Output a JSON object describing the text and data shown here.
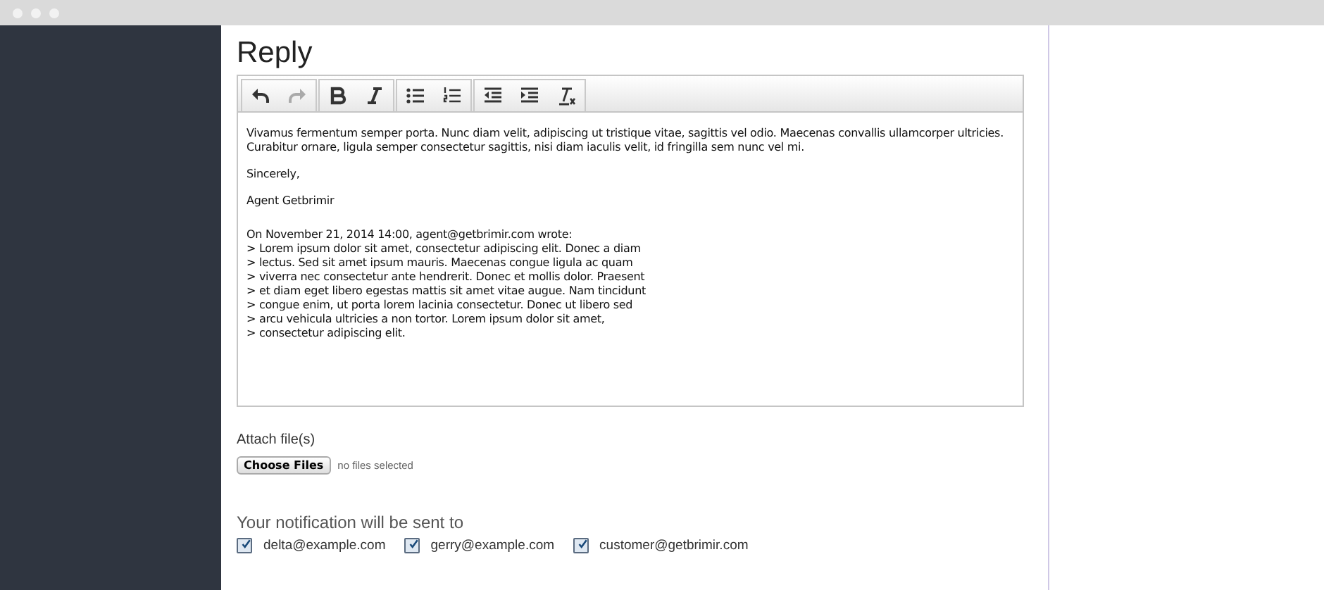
{
  "heading": "Reply",
  "toolbar": [
    {
      "group": [
        {
          "kind": "undo",
          "disabled": false
        },
        {
          "kind": "redo",
          "disabled": true
        }
      ]
    },
    {
      "group": [
        {
          "kind": "bold",
          "disabled": false
        },
        {
          "kind": "italic",
          "disabled": false
        }
      ]
    },
    {
      "group": [
        {
          "kind": "bullets",
          "disabled": false
        },
        {
          "kind": "numbers",
          "disabled": false
        }
      ]
    },
    {
      "group": [
        {
          "kind": "outdent",
          "disabled": false
        },
        {
          "kind": "indent",
          "disabled": false
        },
        {
          "kind": "clear",
          "disabled": false
        }
      ]
    }
  ],
  "body": [
    {
      "kind": "text",
      "lines": [
        "Vivamus fermentum semper porta. Nunc diam velit, adipiscing ut tristique vitae, sagittis vel odio. Maecenas convallis ullamcorper ultricies.",
        "Curabitur ornare, ligula semper consectetur sagittis, nisi diam iaculis velit, id fringilla sem nunc vel mi."
      ]
    },
    {
      "kind": "text",
      "lines": [
        "Sincerely,"
      ]
    },
    {
      "kind": "text",
      "lines": [
        "Agent Getbrimir"
      ]
    },
    {
      "kind": "quote",
      "lines": [
        "On November 21, 2014 14:00, agent@getbrimir.com wrote:",
        "> Lorem ipsum dolor sit amet, consectetur adipiscing elit. Donec a diam",
        "> lectus. Sed sit amet ipsum mauris. Maecenas congue ligula ac quam",
        "> viverra nec consectetur ante hendrerit. Donec et mollis dolor. Praesent",
        "> et diam eget libero egestas mattis sit amet vitae augue. Nam tincidunt",
        "> congue enim, ut porta lorem lacinia consectetur. Donec ut libero sed",
        "> arcu vehicula ultricies a non tortor. Lorem ipsum dolor sit amet,",
        "> consectetur adipiscing elit."
      ]
    }
  ],
  "attach": {
    "label": "Attach file(s)",
    "button": "Choose Files",
    "status": "no files selected"
  },
  "recipients": {
    "title": "Your notification will be sent to",
    "items": [
      {
        "email": "delta@example.com",
        "checked": true
      },
      {
        "email": "gerry@example.com",
        "checked": true
      },
      {
        "email": "customer@getbrimir.com",
        "checked": true
      }
    ]
  }
}
